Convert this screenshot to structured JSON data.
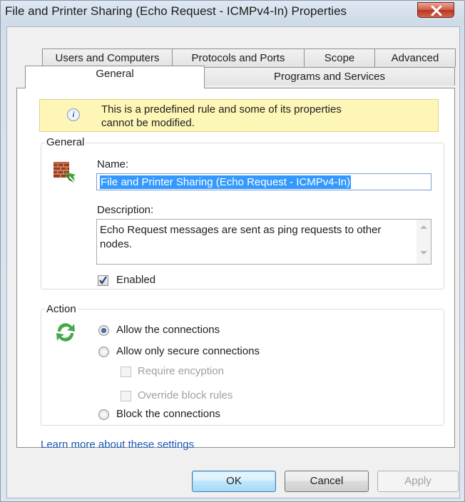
{
  "window": {
    "title": "File and Printer Sharing (Echo Request - ICMPv4-In) Properties"
  },
  "tabs": {
    "back": [
      {
        "label": "Users and Computers"
      },
      {
        "label": "Protocols and Ports"
      },
      {
        "label": "Scope"
      },
      {
        "label": "Advanced"
      }
    ],
    "front": [
      {
        "label": "General",
        "selected": true
      },
      {
        "label": "Programs and Services",
        "selected": false
      }
    ]
  },
  "info": {
    "icon": "info-icon",
    "line1": "This is a predefined rule and some of its properties",
    "line2": "cannot be modified."
  },
  "general": {
    "group_label": "General",
    "name_label": "Name:",
    "name_value": "File and Printer Sharing (Echo Request - ICMPv4-In)",
    "description_label": "Description:",
    "description_line1": "Echo Request messages are sent as ping requests to other",
    "description_line2": "nodes.",
    "enabled_label": "Enabled",
    "enabled_checked": true
  },
  "action": {
    "group_label": "Action",
    "allow_label": "Allow the connections",
    "allow_secure_label": "Allow only secure connections",
    "require_encryption_label": "Require encyption",
    "override_label": "Override block rules",
    "block_label": "Block the connections",
    "selected": "allow"
  },
  "link_text": "Learn more about these settings",
  "buttons": {
    "ok": "OK",
    "cancel": "Cancel",
    "apply": "Apply"
  },
  "colors": {
    "link": "#1a58b6",
    "info_bg": "#fdf6b7",
    "selection": "#3399ff"
  }
}
